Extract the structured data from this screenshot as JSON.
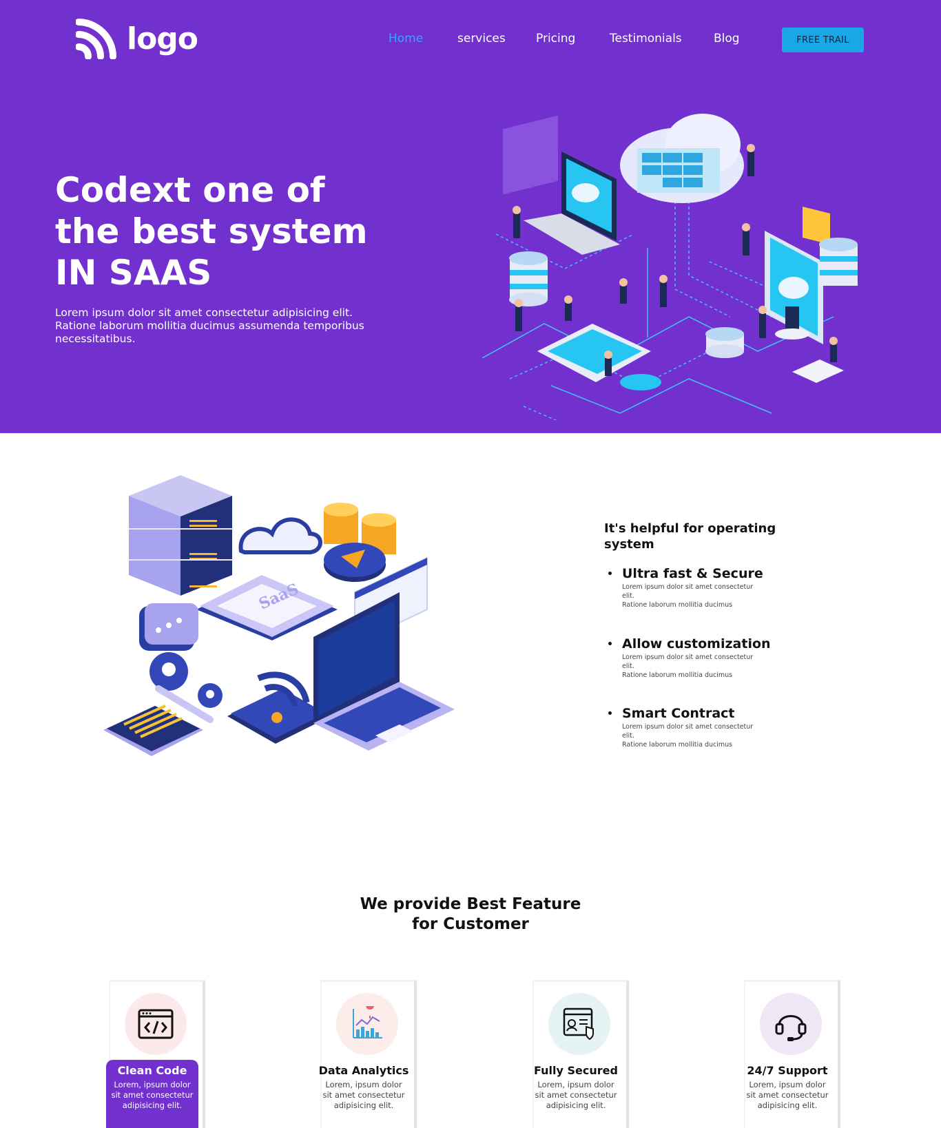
{
  "header": {
    "logo_text": "logo",
    "nav": [
      {
        "label": "Home",
        "active": true
      },
      {
        "label": "services",
        "active": false
      },
      {
        "label": "Pricing",
        "active": false
      },
      {
        "label": "Testimonials",
        "active": false
      },
      {
        "label": "Blog",
        "active": false
      }
    ],
    "cta_label": "FREE TRAIL"
  },
  "hero": {
    "title_lines": [
      "Codext one of",
      "the best system",
      "IN SAAS"
    ],
    "subtitle": "Lorem ipsum dolor sit amet consectetur adipisicing elit. Ratione laborum mollitia ducimus assumenda temporibus necessitatibus."
  },
  "info": {
    "heading": "It's helpful for operating system",
    "features": [
      {
        "title": "Ultra fast & Secure",
        "desc": "Lorem ipsum dolor sit amet consectetur elit.",
        "desc2": "Ratione laborum mollitia ducimus"
      },
      {
        "title": "Allow customization",
        "desc": "Lorem ipsum dolor sit amet consectetur elit.",
        "desc2": "Ratione laborum mollitia ducimus"
      },
      {
        "title": "Smart Contract",
        "desc": "Lorem ipsum dolor sit amet consectetur elit.",
        "desc2": "Ratione laborum mollitia ducimus"
      }
    ]
  },
  "features_section": {
    "title_line1": "We provide Best Feature",
    "title_line2": "for Customer",
    "cards": [
      {
        "title": "Clean Code",
        "desc": "Lorem, ipsum dolor sit amet consectetur adipisicing elit.",
        "icon": "code-window-icon",
        "active": true,
        "circle_color": "#fbe9ec"
      },
      {
        "title": "Data Analytics",
        "desc": "Lorem, ipsum dolor sit amet consectetur adipisicing elit.",
        "icon": "analytics-chart-icon",
        "active": false,
        "circle_color": "#fcecea"
      },
      {
        "title": "Fully Secured",
        "desc": "Lorem, ipsum dolor sit amet consectetur adipisicing elit.",
        "icon": "secure-profile-icon",
        "active": false,
        "circle_color": "#e6f3f4"
      },
      {
        "title": "24/7 Support",
        "desc": "Lorem, ipsum dolor sit amet consectetur adipisicing elit.",
        "icon": "headset-icon",
        "active": false,
        "circle_color": "#efe6f6"
      }
    ]
  },
  "colors": {
    "hero_bg": "#7230cf",
    "nav_active": "#3aa3ff",
    "cta_bg": "#1aa7e8"
  }
}
